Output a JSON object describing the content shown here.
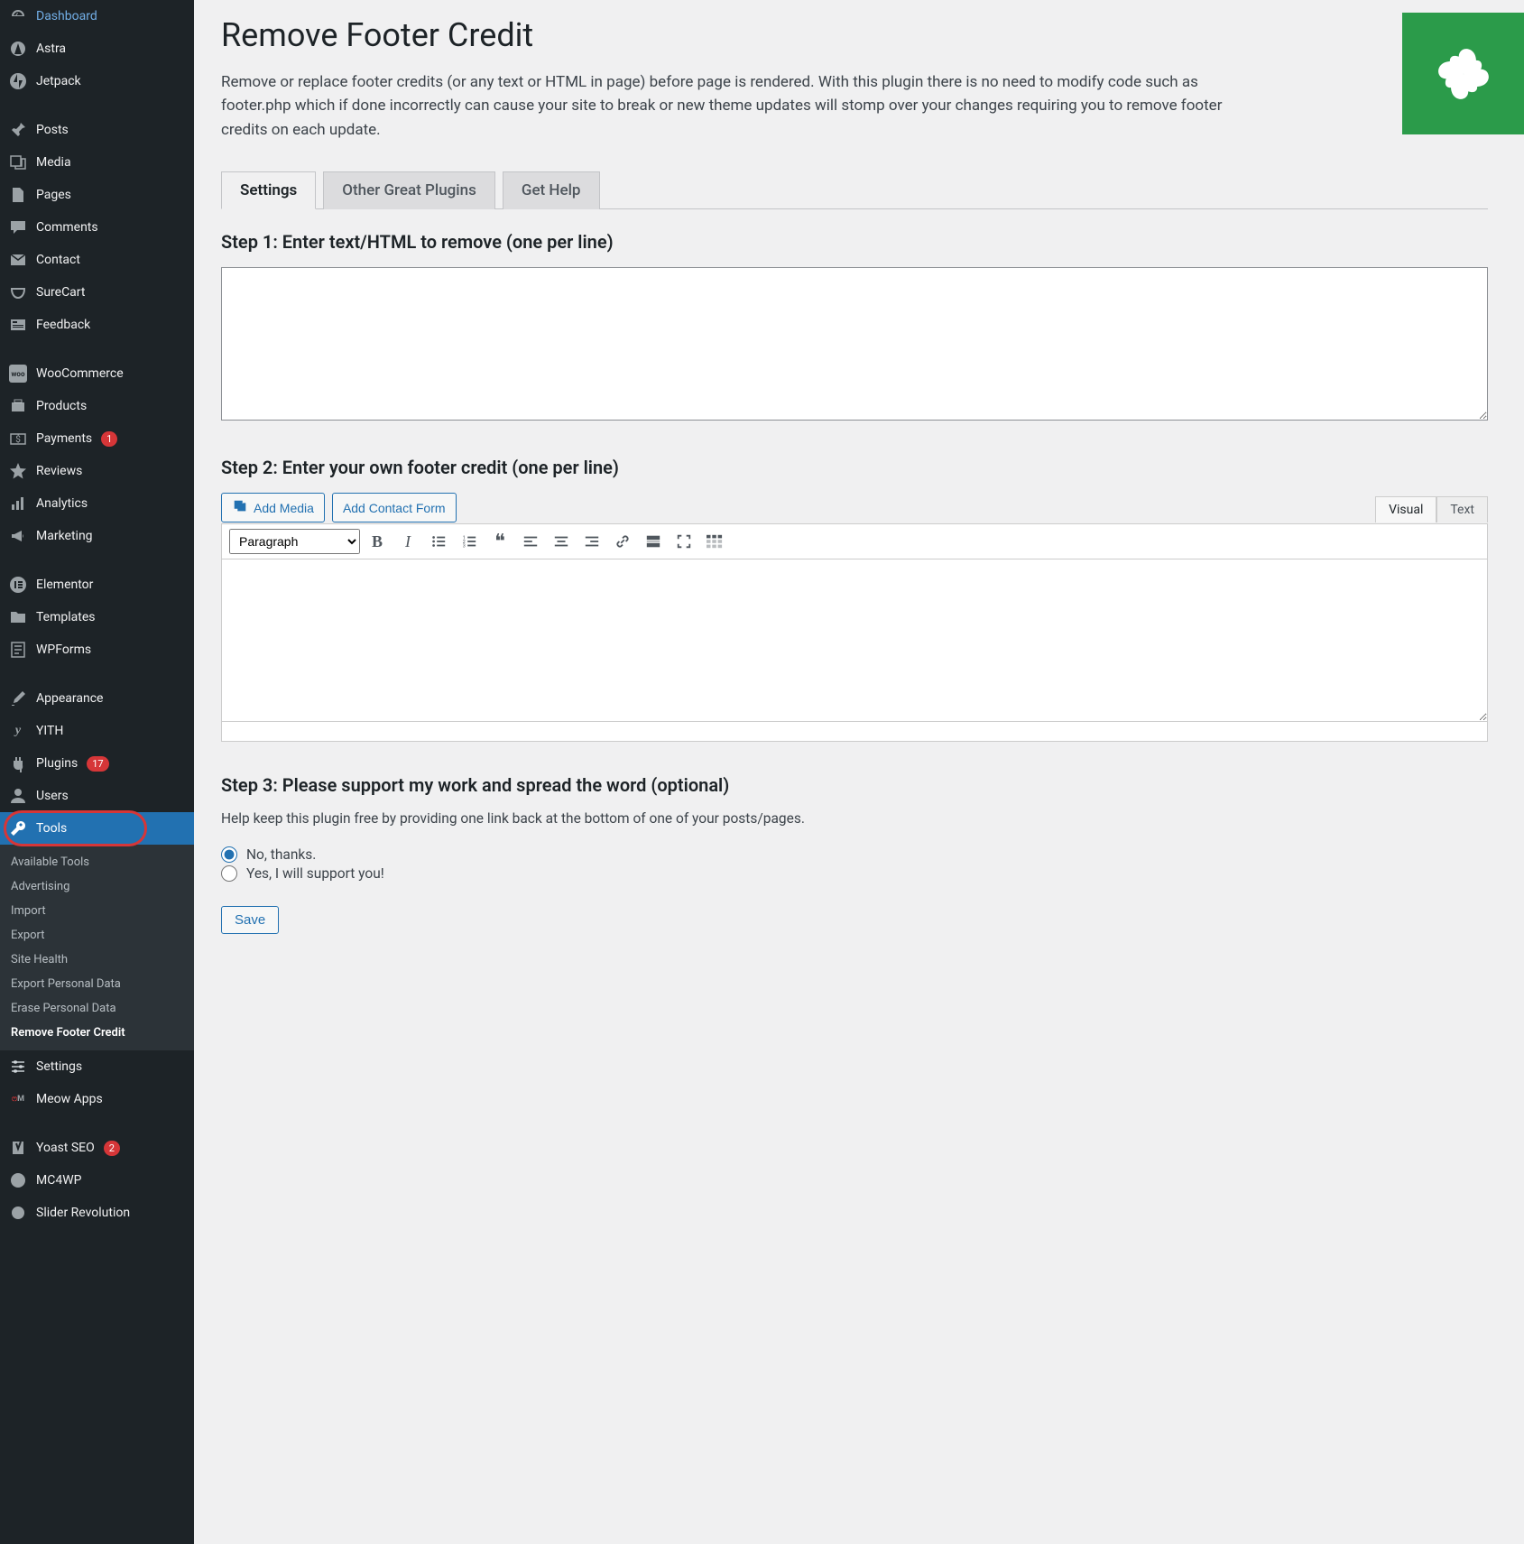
{
  "page": {
    "title": "Remove Footer Credit",
    "description": "Remove or replace footer credits (or any text or HTML in page) before page is rendered. With this plugin there is no need to modify code such as footer.php which if done incorrectly can cause your site to break or new theme updates will stomp over your changes requiring you to remove footer credits on each update."
  },
  "tabs": {
    "settings": "Settings",
    "other": "Other Great Plugins",
    "help": "Get Help"
  },
  "steps": {
    "s1": "Step 1: Enter text/HTML to remove (one per line)",
    "s2": "Step 2: Enter your own footer credit (one per line)",
    "s3": "Step 3: Please support my work and spread the word (optional)"
  },
  "editor": {
    "add_media": "Add Media",
    "add_contact": "Add Contact Form",
    "visual_tab": "Visual",
    "text_tab": "Text",
    "format_select": "Paragraph"
  },
  "support": {
    "text": "Help keep this plugin free by providing one link back at the bottom of one of your posts/pages.",
    "no": "No, thanks.",
    "yes": "Yes, I will support you!"
  },
  "save": "Save",
  "sidebar": {
    "dashboard": "Dashboard",
    "astra": "Astra",
    "jetpack": "Jetpack",
    "posts": "Posts",
    "media": "Media",
    "pages": "Pages",
    "comments": "Comments",
    "contact": "Contact",
    "surecart": "SureCart",
    "feedback": "Feedback",
    "woocommerce": "WooCommerce",
    "products": "Products",
    "payments": "Payments",
    "payments_badge": "1",
    "reviews": "Reviews",
    "analytics": "Analytics",
    "marketing": "Marketing",
    "elementor": "Elementor",
    "templates": "Templates",
    "wpforms": "WPForms",
    "appearance": "Appearance",
    "yith": "YITH",
    "plugins": "Plugins",
    "plugins_badge": "17",
    "users": "Users",
    "tools": "Tools",
    "settings": "Settings",
    "meow": "Meow Apps",
    "yoast": "Yoast SEO",
    "yoast_badge": "2",
    "mc4wp": "MC4WP",
    "slider": "Slider Revolution"
  },
  "submenu": {
    "available": "Available Tools",
    "advertising": "Advertising",
    "import": "Import",
    "export": "Export",
    "sitehealth": "Site Health",
    "exportpd": "Export Personal Data",
    "erasepd": "Erase Personal Data",
    "rfc": "Remove Footer Credit"
  }
}
